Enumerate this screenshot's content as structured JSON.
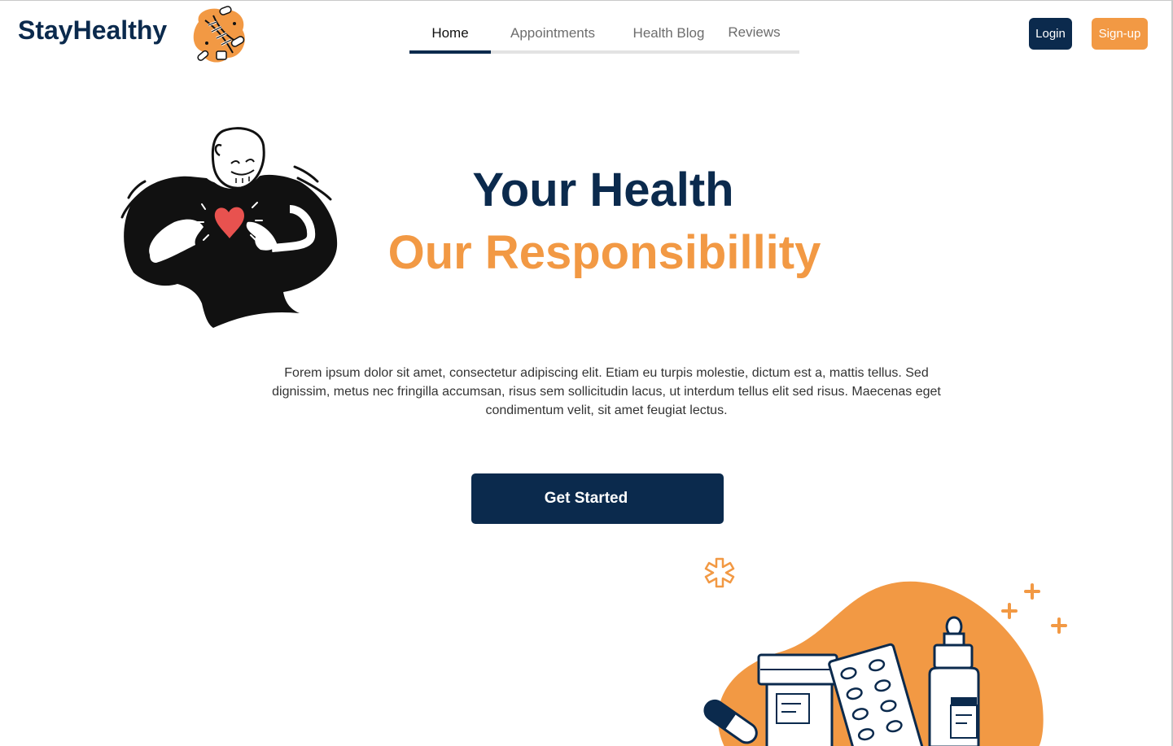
{
  "brand": {
    "name": "StayHealthy",
    "logo_icon": "dna-pills-logo-icon"
  },
  "nav": {
    "items": [
      {
        "label": "Home",
        "active": true
      },
      {
        "label": "Appointments",
        "active": false
      },
      {
        "label": "Health Blog",
        "active": false
      },
      {
        "label": "Reviews",
        "active": false
      }
    ]
  },
  "auth": {
    "login_label": "Login",
    "signup_label": "Sign-up"
  },
  "hero": {
    "headline_primary": "Your Health",
    "headline_secondary": "Our Responsibillity",
    "description": "Forem ipsum dolor sit amet, consectetur adipiscing elit. Etiam eu turpis molestie, dictum est a, mattis tellus. Sed dignissim, metus nec fringilla accumsan, risus sem sollicitudin lacus, ut interdum tellus elit sed risus. Maecenas eget condimentum velit, sit amet feugiat lectus.",
    "cta_label": "Get Started",
    "illustration_icon": "person-heart-illustration",
    "medicine_icon": "medicine-bottles-illustration"
  },
  "colors": {
    "navy": "#0b2a4d",
    "orange": "#f29944",
    "heart": "#e8524f"
  }
}
